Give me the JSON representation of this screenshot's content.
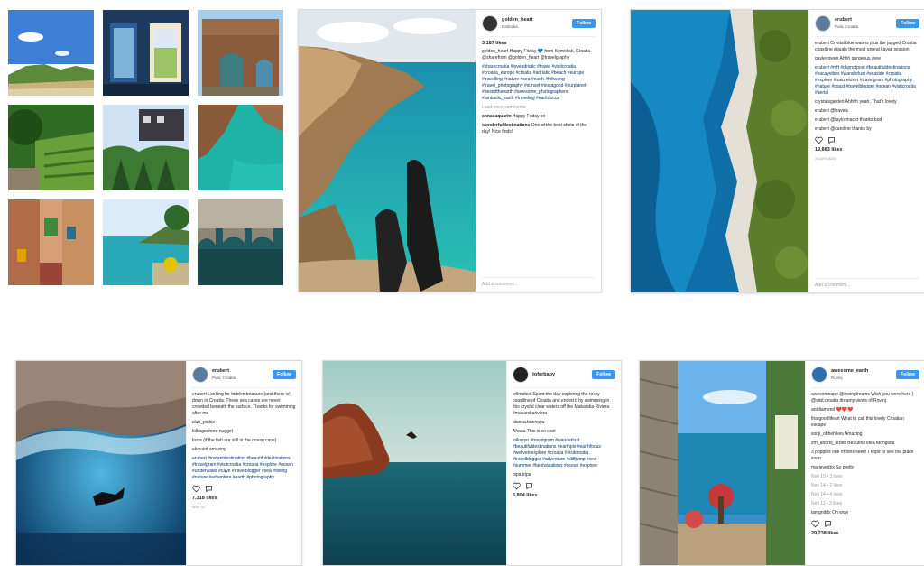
{
  "post1": {
    "username": "golden_heart",
    "location": "Dalmatia",
    "follow": "Follow",
    "likes": "3,187 likes",
    "caption": "golden_heart Happy Friday 💙 from Komoljak, Croatia @sharefrom @golden_heart @travelgraphy",
    "hashtags": "#sharecroatia #loveadriatic #travel #visitcroatia #croatia_europe #croatia #adriatic #beach #europe #travelling #nature #sea #earth #folkvang #travel_photography #sunset #instagood #ourplanet #bestoftheearth #awesome_photographers #fantastic_earth #traveling #earthfocus",
    "more_comments": "Load more comments",
    "comment1_user": "annasaquarin",
    "comment1_text": "Happy Friday sir",
    "comment2_user": "wonderfuldestinations",
    "comment2_text": "One of the best shots of the day! Nice finds!",
    "add_comment": "Add a comment..."
  },
  "post2": {
    "username": "erubert",
    "location": "Pula, Croatia",
    "follow": "Follow",
    "caption": "erubert Crystal blue waters plus the jagged Croatia coastline equals the most unreal kayak session",
    "comment_a": "gayleyowen Ahhh gorgeous view",
    "hashtags": "erubert #mft #dkpnotpost #beautifuldestinations #vacayvibes #wanderlust #seaside #croatia #explore #naturelover #travelgram #photography #nature #coast #travelblogger #ocean #visitcroatia #aerial",
    "comment_b": "crystalsgarden Ahhhh yeah, That's lovely",
    "comment_c": "erubert @travels",
    "comment_d": "erubert @taylormacer thanks bud",
    "comment_e": "erubert @caroline thanks by",
    "likes": "19,883 likes",
    "time": "3 DAYS AGO",
    "add_comment": "Add a comment..."
  },
  "post3": {
    "username": "erubert",
    "location": "Pula, Croatia",
    "follow": "Follow",
    "caption": "erubert Looking for hidden treasure (and there is!) down in Croatia. These sea caves are never crowded beneath the surface. Thanks for swimming after me",
    "comment_a": "club_pinkie",
    "comment_b": "lolkageshore nugget",
    "comment_c": "Insta (if the fish are still in the ocean cave)",
    "comment_d": "ekovant amazing",
    "hashtags": "erubert #instantdestination #beautifuldestinations #travelgram #visitcroatia #croatia #explore #ocean #underwater #cave #travelblogger #sea #diving #nature #adventure #earth #photography",
    "likes": "7,318 likes",
    "time": "MAY 31",
    "add_comment": "Add a comment..."
  },
  "post4": {
    "username": "toferbaby",
    "follow": "Follow",
    "caption": "tellmeboil Spent the day exploring the rocky coastline of Croatia and ended it by swimming in this crystal clear waters off the Makarska Riviera #makarskariviera",
    "comment_a": "blanca.buenaya",
    "comment_b": "Ahaaa This is so cool",
    "hashtags": "lolkasyn #travelgram #wanderlust #beautifuldestinations #earthpix #earthfocus #welivetoexplore #croatia #visitcroatia #travelblogger #adventure #cliffjump #sea #summer #bestvacations #ocean #explore",
    "comment_c": "pipa.tripa",
    "likes": "5,804 likes",
    "add_comment": "Add a comment..."
  },
  "post5": {
    "username": "awesome_earth",
    "location": "Rovinj",
    "follow": "Follow",
    "caption": "awesomeapp @rovinjdreams Wish you were here ) @visit.croatia dreamy views of Rovinj",
    "comment_a": "antdiamond ❤️❤️❤️",
    "comment_b": "thatgoodlifeart What to call this lovely Croatian escape",
    "comment_c": "sonji_ofthehikes Amazing",
    "comment_d": "zrn_andrej_arbeit Beautiful idea Mongolia",
    "comment_e": "3 poppies one of tons seen! I hope to see the place soon",
    "comment_f": "marievedrix So pretty",
    "comment_g": "Nov 19 • 3 likes",
    "comment_h": "Nov 14 • 2 likes",
    "comment_i": "Nov 14 • 4 likes",
    "comment_j": "Nov 11 • 3 likes",
    "comment_k": "iamgridds Oh wow",
    "likes": "29,238 likes",
    "add_comment": "Add a comment..."
  },
  "colors": {
    "follow": "#3897f0",
    "hashtag": "#003569",
    "border": "#dbdbdb"
  }
}
